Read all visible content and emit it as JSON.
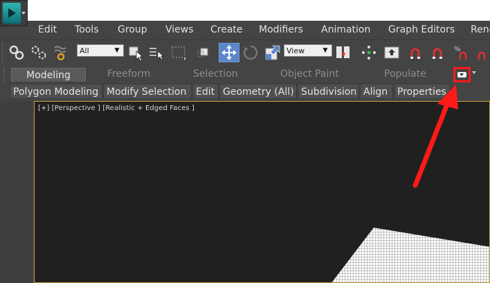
{
  "menu": {
    "items": [
      "Edit",
      "Tools",
      "Group",
      "Views",
      "Create",
      "Modifiers",
      "Animation",
      "Graph Editors",
      "Rend"
    ]
  },
  "toolbar": {
    "selection_filter": "All",
    "reference_coord": "View"
  },
  "ribbon": {
    "tabs": [
      "Modeling",
      "Freeform",
      "Selection",
      "Object Paint",
      "Populate"
    ],
    "active_tab": "Modeling",
    "panels": [
      "Polygon Modeling",
      "Modify Selection",
      "Edit",
      "Geometry (All)",
      "Subdivision",
      "Align",
      "Properties"
    ]
  },
  "viewport": {
    "label": "[+] [Perspective ] [Realistic + Edged Faces ]"
  },
  "colors": {
    "annotation": "#ff1a1a",
    "viewport_border": "#c9a53c",
    "logo": "#1a9aa0"
  }
}
